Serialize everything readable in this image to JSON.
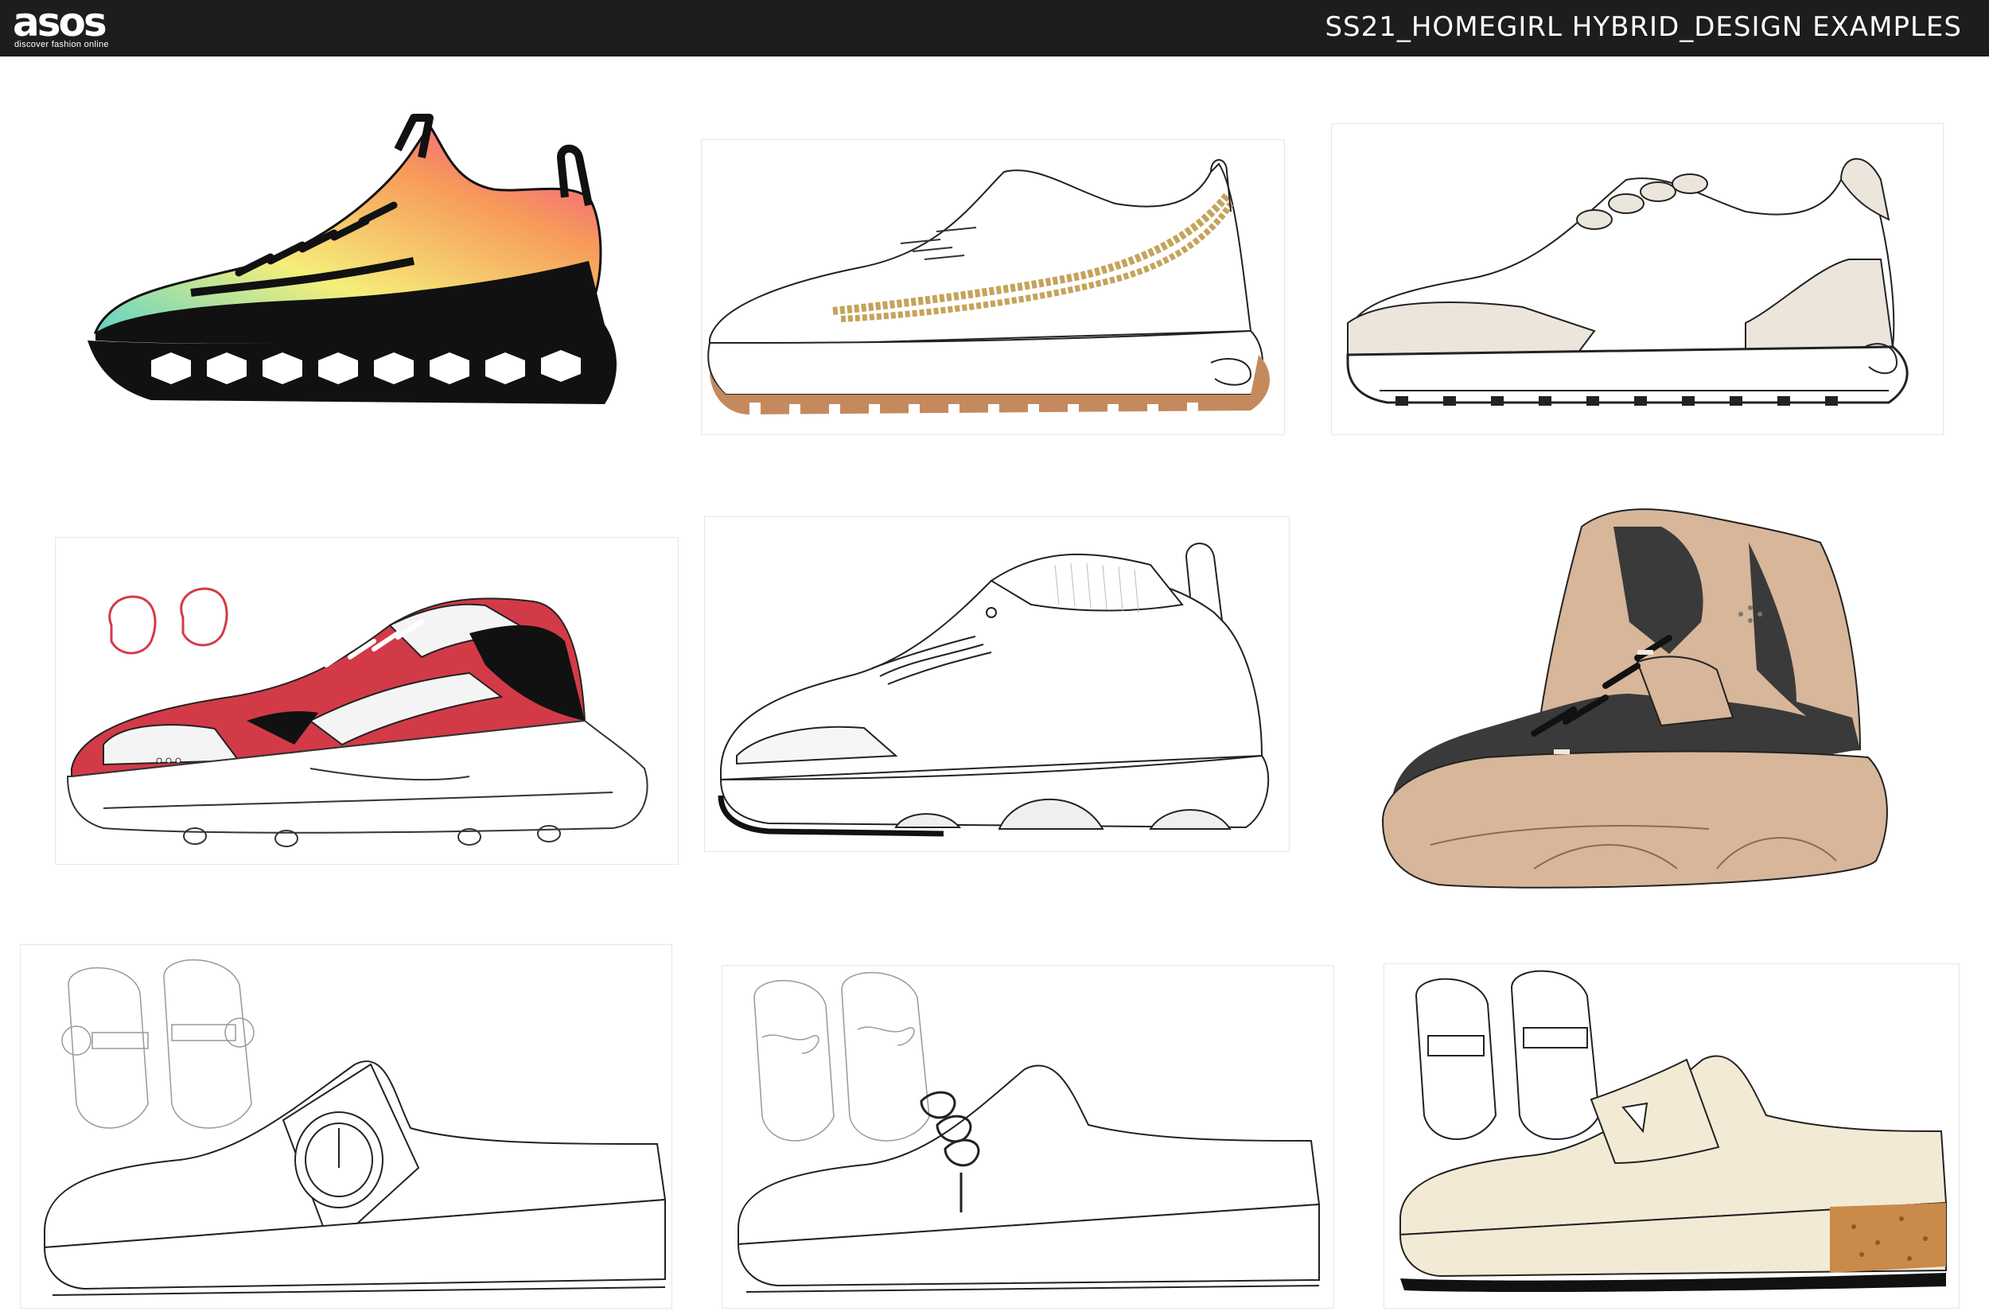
{
  "header": {
    "brand": "asos",
    "tagline": "discover fashion online",
    "title": "SS21_HOMEGIRL HYBRID_DESIGN EXAMPLES"
  },
  "colors": {
    "header_bg": "#1f1c1d",
    "gradient": [
      "#5fd3c8",
      "#f5ee7a",
      "#f79a5a",
      "#f2439a"
    ],
    "gold_chain": "#c5a35a",
    "gum_sole": "#c48a5e",
    "cream": "#ebe5dc",
    "red": "#d33a47",
    "tan": "#d7b69a",
    "charcoal": "#3a3a3a",
    "ivory": "#f2ead5",
    "cork": "#c98a4a"
  },
  "panels": [
    {
      "name": "gradient-hexsole-sneaker-sketch",
      "icon": "sneaker-icon"
    },
    {
      "name": "chain-gum-sole-sneaker-sketch",
      "icon": "sneaker-icon"
    },
    {
      "name": "cream-suede-runner-sketch",
      "icon": "sneaker-icon"
    },
    {
      "name": "red-chunky-sneaker-sketch",
      "icon": "sneaker-icon"
    },
    {
      "name": "knit-collar-toggle-sneaker-sketch",
      "icon": "sneaker-icon"
    },
    {
      "name": "tan-charcoal-hightop-sketch",
      "icon": "boot-icon"
    },
    {
      "name": "buckle-clog-mule-sketch",
      "icon": "clog-icon"
    },
    {
      "name": "knot-chain-clog-mule-sketch",
      "icon": "clog-icon"
    },
    {
      "name": "penny-loafer-cork-mule-sketch",
      "icon": "clog-icon"
    }
  ]
}
